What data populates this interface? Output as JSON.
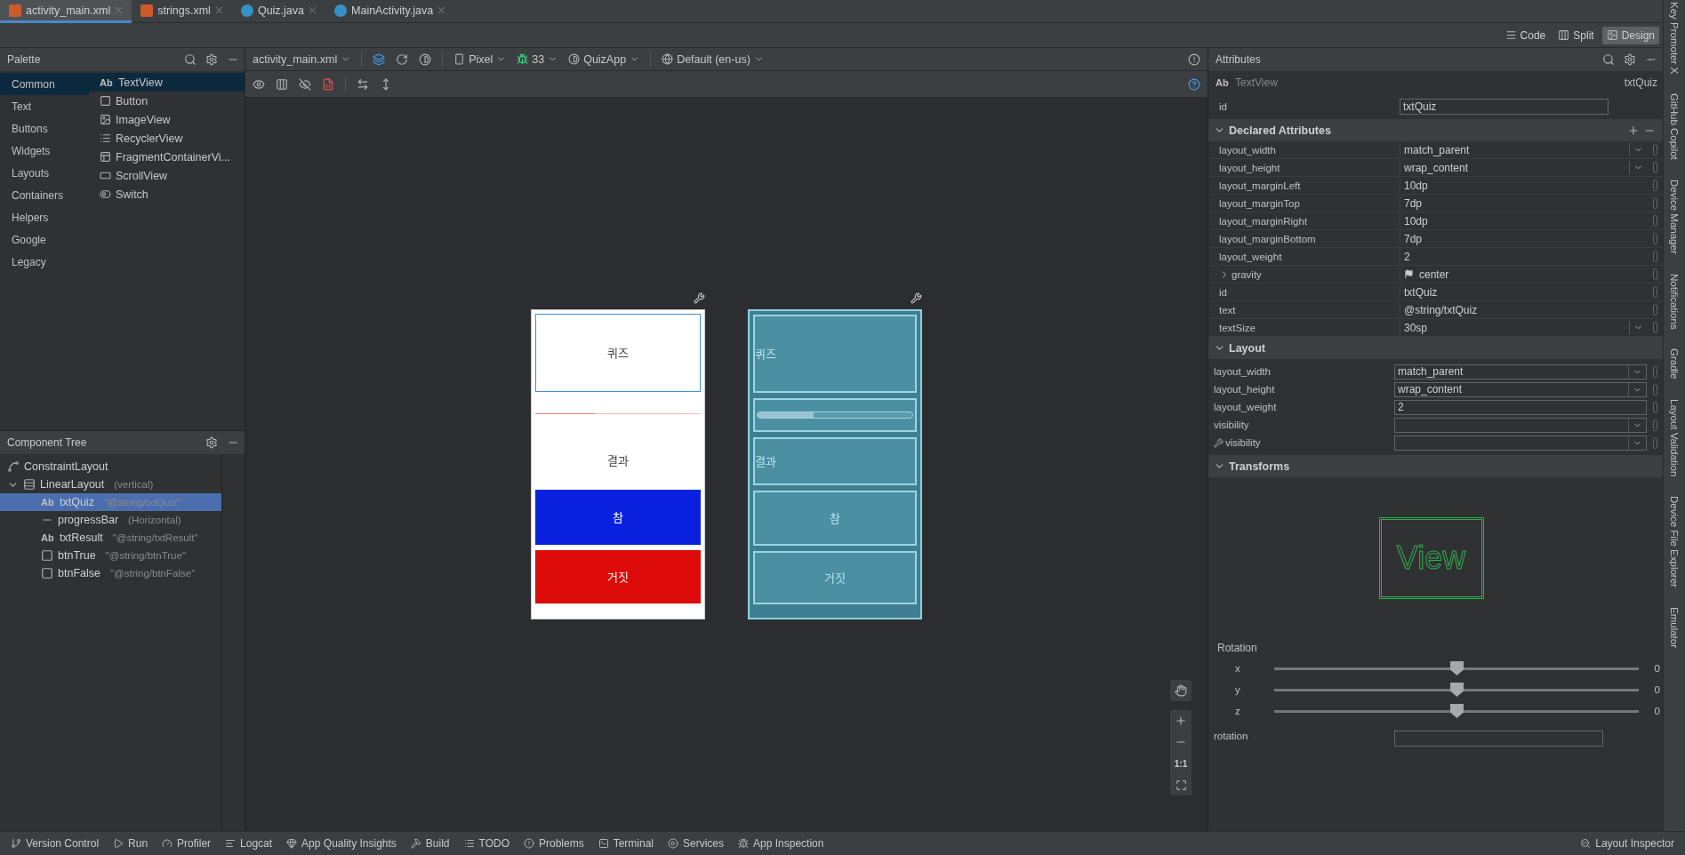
{
  "editor_tabs": [
    {
      "label": "activity_main.xml",
      "kind": "xml",
      "selected": true
    },
    {
      "label": "strings.xml",
      "kind": "xml",
      "selected": false
    },
    {
      "label": "Quiz.java",
      "kind": "class",
      "selected": false
    },
    {
      "label": "MainActivity.java",
      "kind": "class",
      "selected": false
    }
  ],
  "view_modes": [
    {
      "label": "Code",
      "kind": "code",
      "selected": false
    },
    {
      "label": "Split",
      "kind": "split",
      "selected": false
    },
    {
      "label": "Design",
      "kind": "design",
      "selected": true
    }
  ],
  "palette": {
    "title": "Palette",
    "categories": [
      {
        "label": "Common",
        "selected": true
      },
      {
        "label": "Text",
        "selected": false
      },
      {
        "label": "Buttons",
        "selected": false
      },
      {
        "label": "Widgets",
        "selected": false
      },
      {
        "label": "Layouts",
        "selected": false
      },
      {
        "label": "Containers",
        "selected": false
      },
      {
        "label": "Helpers",
        "selected": false
      },
      {
        "label": "Google",
        "selected": false
      },
      {
        "label": "Legacy",
        "selected": false
      }
    ],
    "items": [
      {
        "label": "TextView",
        "kind": "text",
        "glyph": "Ab",
        "selected": true
      },
      {
        "label": "Button",
        "kind": "button",
        "selected": false
      },
      {
        "label": "ImageView",
        "kind": "image",
        "selected": false
      },
      {
        "label": "RecyclerView",
        "kind": "list",
        "selected": false
      },
      {
        "label": "FragmentContainerVi...",
        "kind": "fragment",
        "selected": false
      },
      {
        "label": "ScrollView",
        "kind": "scroll",
        "selected": false
      },
      {
        "label": "Switch",
        "kind": "switch",
        "selected": false
      }
    ]
  },
  "component_tree": {
    "title": "Component Tree",
    "items": [
      {
        "label": "ConstraintLayout",
        "kind": "constraint",
        "selected": false
      },
      {
        "label": "LinearLayout",
        "hint": "(vertical)",
        "kind": "linear",
        "expanded": true,
        "selected": false,
        "children": [
          {
            "label": "txtQuiz",
            "hint": "\"@string/txtQuiz\"",
            "kind": "text",
            "glyph": "Ab",
            "selected": true
          },
          {
            "label": "progressBar",
            "hint": "(Horizontal)",
            "kind": "progress",
            "selected": false
          },
          {
            "label": "txtResult",
            "hint": "\"@string/txtResult\"",
            "kind": "text",
            "glyph": "Ab",
            "selected": false
          },
          {
            "label": "btnTrue",
            "hint": "\"@string/btnTrue\"",
            "kind": "button",
            "selected": false
          },
          {
            "label": "btnFalse",
            "hint": "\"@string/btnFalse\"",
            "kind": "button",
            "selected": false
          }
        ]
      }
    ]
  },
  "design_toolbar": {
    "file": "activity_main.xml",
    "device": "Pixel",
    "api": "33",
    "theme": "QuizApp",
    "locale": "Default (en-us)"
  },
  "preview": {
    "quiz": "퀴즈",
    "progress": {
      "level": 0.36
    },
    "result": "결과",
    "true_button": "참",
    "false_button": "거짓"
  },
  "blueprint": {
    "quiz": "퀴즈",
    "progress": {
      "level": 0.36
    },
    "result": "결과",
    "true_button": "참",
    "false_button": "거짓"
  },
  "zoom_controls": {
    "reset_label": "1:1"
  },
  "attributes": {
    "title": "Attributes",
    "widget_glyph": "Ab",
    "widget_type": "TextView",
    "widget_id": "txtQuiz",
    "id_label": "id",
    "id_value": "txtQuiz",
    "sections": [
      {
        "title": "Declared Attributes",
        "expanded": true,
        "kind": "plain",
        "rows": [
          {
            "name": "layout_width",
            "value": "match_parent",
            "kind": "dropdown"
          },
          {
            "name": "layout_height",
            "value": "wrap_content",
            "kind": "dropdown"
          },
          {
            "name": "layout_marginLeft",
            "value": "10dp",
            "kind": "text"
          },
          {
            "name": "layout_marginTop",
            "value": "7dp",
            "kind": "text"
          },
          {
            "name": "layout_marginRight",
            "value": "10dp",
            "kind": "text"
          },
          {
            "name": "layout_marginBottom",
            "value": "7dp",
            "kind": "text"
          },
          {
            "name": "layout_weight",
            "value": "2",
            "kind": "text"
          },
          {
            "name": "gravity",
            "value": "center",
            "kind": "flag"
          },
          {
            "name": "id",
            "value": "txtQuiz",
            "kind": "text"
          },
          {
            "name": "text",
            "value": "@string/txtQuiz",
            "kind": "text"
          },
          {
            "name": "textSize",
            "value": "30sp",
            "kind": "dropdown"
          }
        ]
      },
      {
        "title": "Layout",
        "expanded": true,
        "kind": "boxed",
        "rows": [
          {
            "name": "layout_width",
            "value": "match_parent",
            "kind": "dropdown"
          },
          {
            "name": "layout_height",
            "value": "wrap_content",
            "kind": "dropdown"
          },
          {
            "name": "layout_weight",
            "value": "2",
            "kind": "text"
          },
          {
            "name": "visibility",
            "kind": "dropdown"
          },
          {
            "name": "visibility",
            "kind": "tool-dropdown"
          }
        ]
      }
    ],
    "transforms": {
      "title": "Transforms",
      "expanded": true,
      "preview_label": "View",
      "rotation_title": "Rotation",
      "axes": [
        {
          "label": "x",
          "level": 0.5,
          "reading": "0"
        },
        {
          "label": "y",
          "level": 0.5,
          "reading": "0"
        },
        {
          "label": "z",
          "level": 0.5,
          "reading": "0"
        }
      ],
      "rotation_field": "rotation"
    }
  },
  "side_tools": [
    "Key Promoter X",
    "GitHub Copilot",
    "Device Manager",
    "Notifications",
    "Gradle",
    "Layout Validation",
    "Device File Explorer",
    "Emulator"
  ],
  "status_bar": {
    "items": [
      {
        "label": "Version Control",
        "kind": "vcs"
      },
      {
        "label": "Run",
        "kind": "run"
      },
      {
        "label": "Profiler",
        "kind": "profiler"
      },
      {
        "label": "Logcat",
        "kind": "logcat"
      },
      {
        "label": "App Quality Insights",
        "kind": "insights"
      },
      {
        "label": "Build",
        "kind": "build"
      },
      {
        "label": "TODO",
        "kind": "todo"
      },
      {
        "label": "Problems",
        "kind": "problems"
      },
      {
        "label": "Terminal",
        "kind": "terminal"
      },
      {
        "label": "Services",
        "kind": "services"
      },
      {
        "label": "App Inspection",
        "kind": "inspection"
      }
    ],
    "right": "Layout Inspector"
  }
}
